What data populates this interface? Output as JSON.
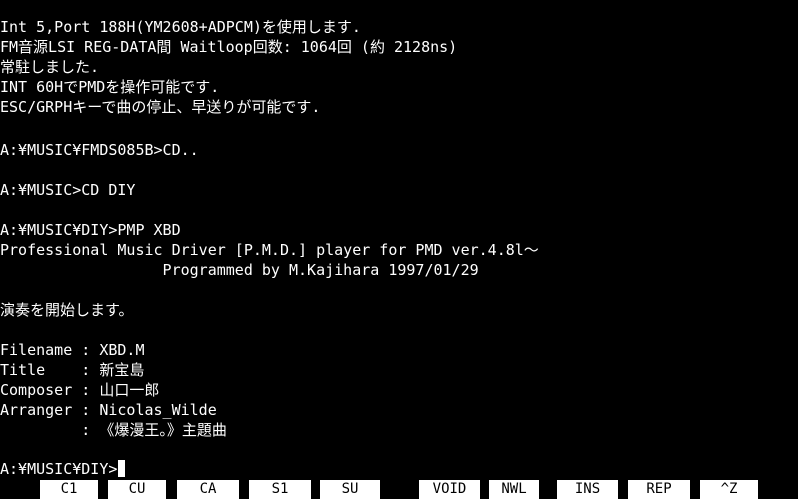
{
  "terminal": {
    "lines": [
      "Int 5,Port 188H(YM2608+ADPCM)を使用します.",
      "FM音源LSI REG-DATA間 Waitloop回数: 1064回 (約 2128ns)",
      "常駐しました.",
      "INT 60HでPMDを操作可能です.",
      "ESC/GRPHキーで曲の停止、早送りが可能です.",
      "",
      "A:¥MUSIC¥FMDS085B>CD..",
      "",
      "A:¥MUSIC>CD DIY",
      "",
      "A:¥MUSIC¥DIY>PMP XBD",
      "Professional Music Driver [P.M.D.] player for PMD ver.4.8l～",
      "                  Programmed by M.Kajihara 1997/01/29",
      "",
      "演奏を開始します。",
      "",
      "Filename : XBD.M",
      "Title    : 新宝島",
      "Composer : 山口一郎",
      "Arranger : Nicolas_Wilde",
      "         : 《爆漫王。》主題曲",
      "",
      "A:¥MUSIC¥DIY>"
    ]
  },
  "function_keys": [
    {
      "label": "C1"
    },
    {
      "label": "CU"
    },
    {
      "label": "CA"
    },
    {
      "label": "S1"
    },
    {
      "label": "SU"
    },
    {
      "label": "VOID"
    },
    {
      "label": "NWL"
    },
    {
      "label": "INS"
    },
    {
      "label": "REP"
    },
    {
      "label": "^Z"
    }
  ],
  "colors": {
    "background": "#000000",
    "text": "#ffffff",
    "function_key_bg": "#ffffff",
    "function_key_text": "#000000"
  }
}
